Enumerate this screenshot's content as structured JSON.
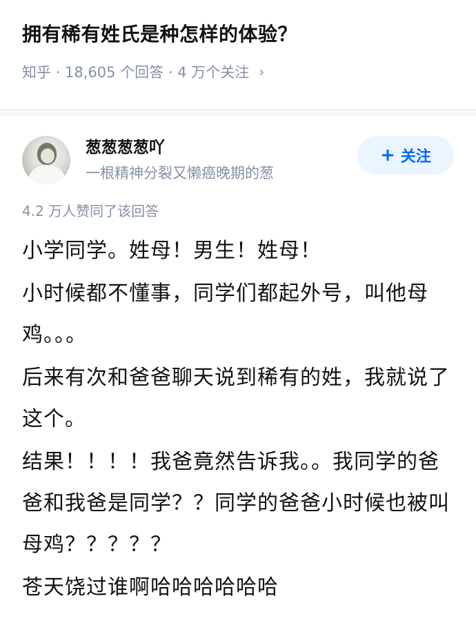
{
  "question": {
    "title": "拥有稀有姓氏是种怎样的体验？",
    "meta": "知乎 · 18,605 个回答 · 4 万个关注",
    "chevron": "›"
  },
  "author": {
    "name": "葱葱葱葱吖",
    "bio": "一根精神分裂又懒癌晚期的葱",
    "avatar_icon": "avatar-photo"
  },
  "follow": {
    "plus": "+",
    "label": "关注"
  },
  "vote_summary": "4.2 万人赞同了该回答",
  "answer_paragraphs": [
    "小学同学。姓母！男生！姓母！",
    "小时候都不懂事，同学们都起外号，叫他母鸡。。。",
    "后来有次和爸爸聊天说到稀有的姓，我就说了这个。",
    "结果！！！！我爸竟然告诉我。。我同学的爸爸和我爸是同学？？同学的爸爸小时候也被叫母鸡？？？？？",
    "苍天饶过谁啊哈哈哈哈哈哈"
  ],
  "colors": {
    "accent": "#0066ff",
    "accent_bg": "#ebf5ff",
    "meta_gray": "#8590a6",
    "text": "#121212"
  }
}
